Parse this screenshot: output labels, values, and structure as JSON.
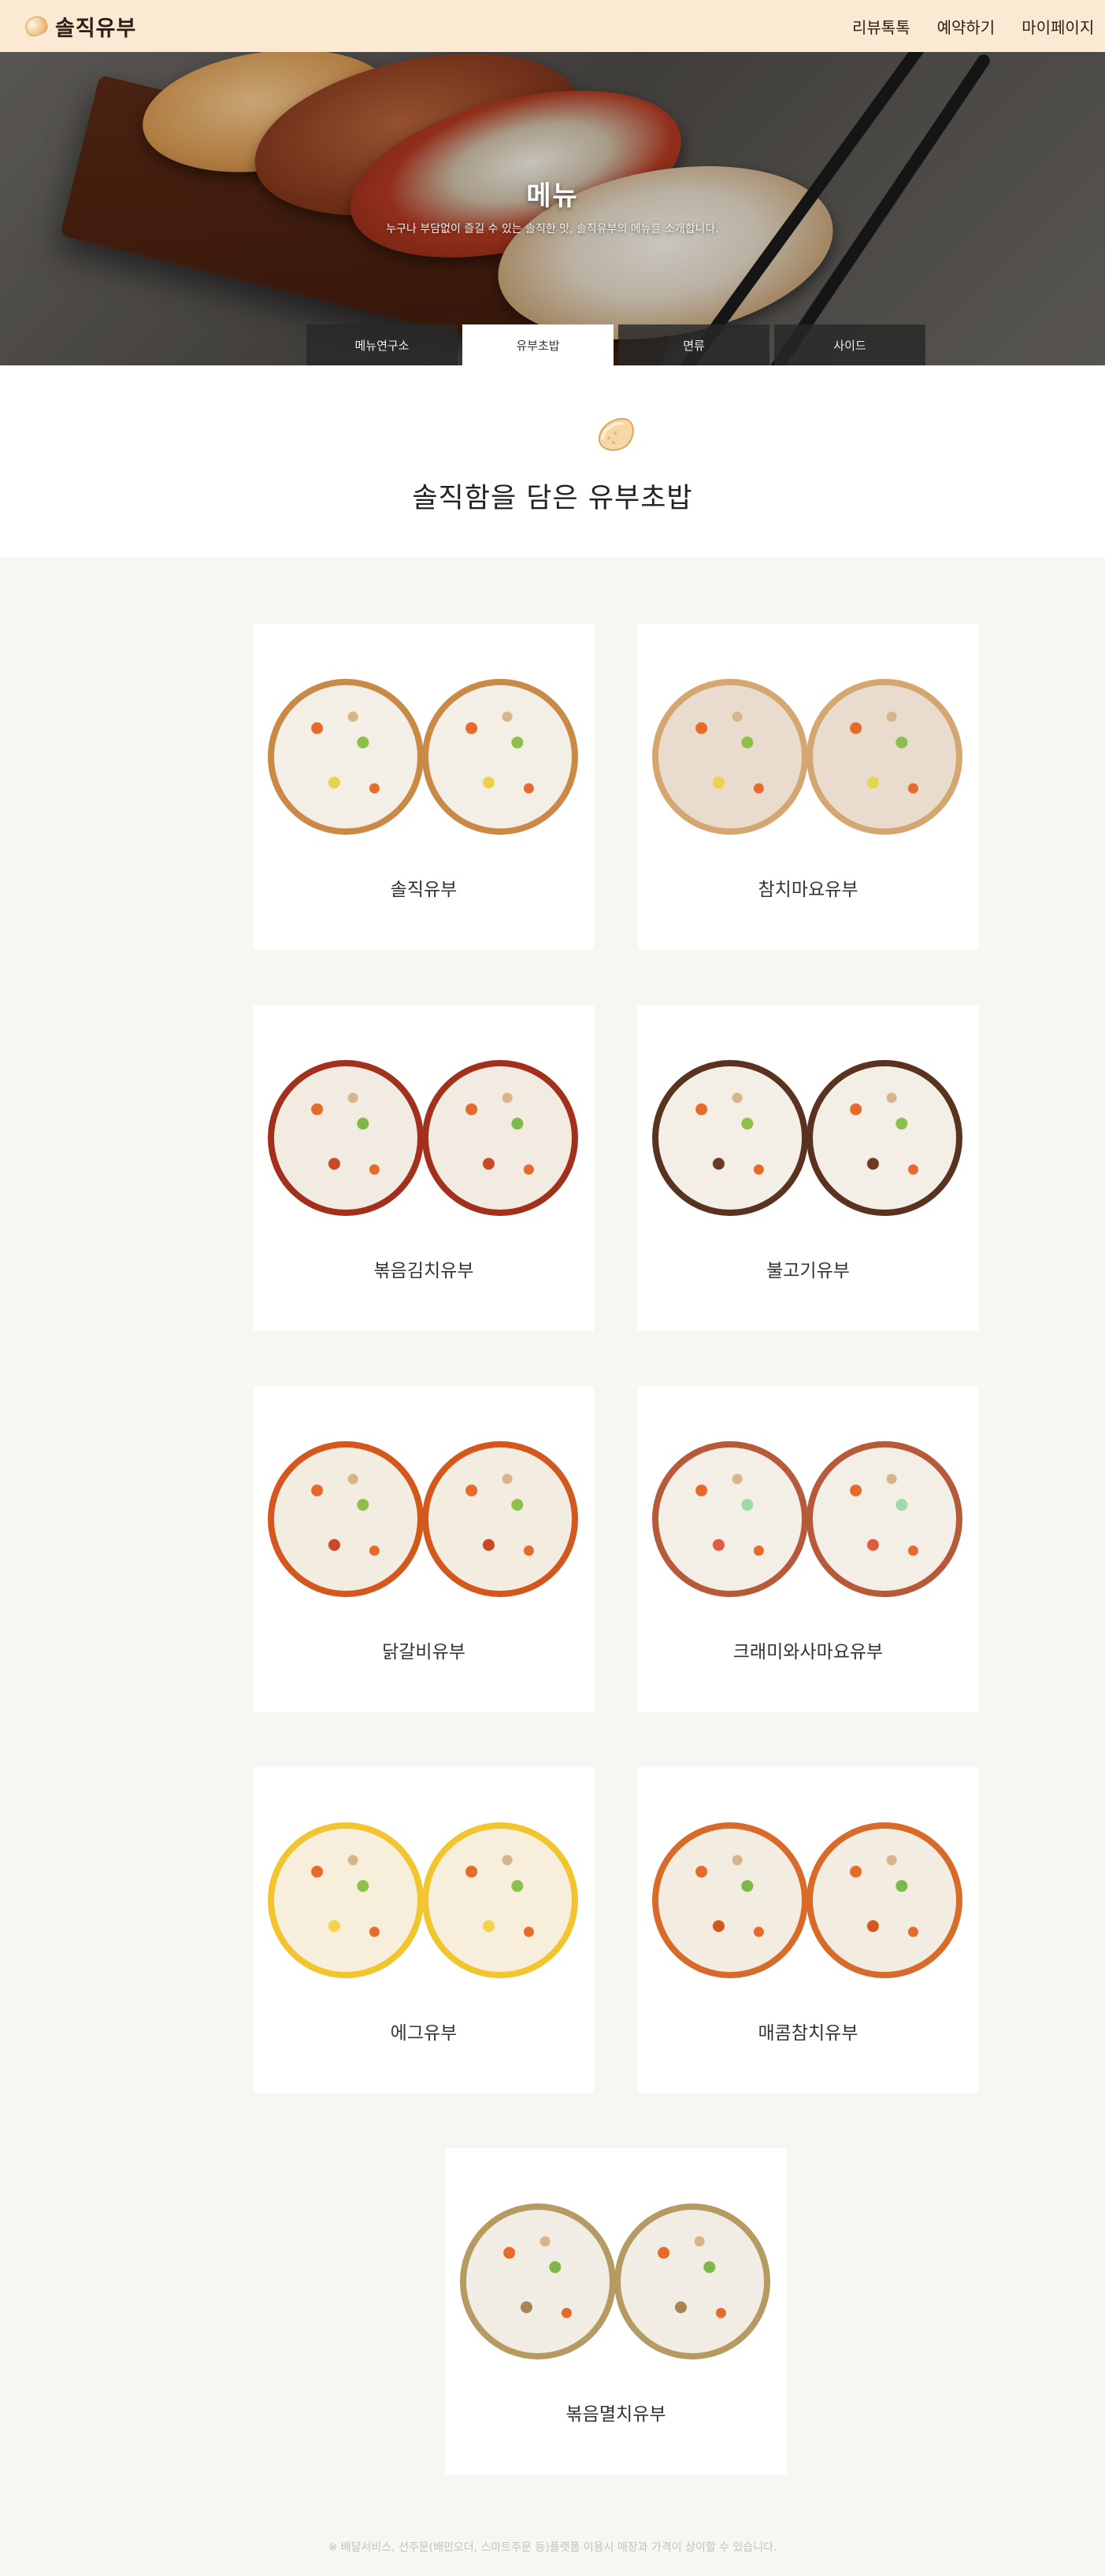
{
  "header": {
    "brand": "솔직유부",
    "nav": [
      "리뷰톡톡",
      "예약하기",
      "마이페이지"
    ]
  },
  "hero": {
    "title": "메뉴",
    "subtitle": "누구나 부담없이 즐길 수 있는 솔직한 맛, 솔직유부의 메뉴를 소개합니다.",
    "tabs": [
      "메뉴연구소",
      "유부초밥",
      "면류",
      "사이드"
    ],
    "active_tab": "유부초밥"
  },
  "section": {
    "title": "솔직함을 담은 유부초밥"
  },
  "menu": [
    {
      "name": "솔직유부",
      "fill": "#f3eee6",
      "skin": "#c98a45",
      "v1": "#e86a2a",
      "v2": "#8cc04a",
      "v3": "#e8d44a"
    },
    {
      "name": "참치마요유부",
      "fill": "#e9dccf",
      "skin": "#d4a670",
      "v1": "#e86a2a",
      "v2": "#8cc04a",
      "v3": "#e8d44a"
    },
    {
      "name": "볶음김치유부",
      "fill": "#f1ebe1",
      "skin": "#a3301d",
      "v1": "#e86a2a",
      "v2": "#7db84a",
      "v3": "#c84828"
    },
    {
      "name": "불고기유부",
      "fill": "#f3eee6",
      "skin": "#5a3220",
      "v1": "#e86a2a",
      "v2": "#8cc04a",
      "v3": "#6a3a22"
    },
    {
      "name": "닭갈비유부",
      "fill": "#f3ece1",
      "skin": "#d4581e",
      "v1": "#e86a2a",
      "v2": "#8cc04a",
      "v3": "#c84828"
    },
    {
      "name": "크래미와사마요유부",
      "fill": "#f4efe6",
      "skin": "#b65a3a",
      "v1": "#e86a2a",
      "v2": "#9ed9a8",
      "v3": "#e05a45"
    },
    {
      "name": "에그유부",
      "fill": "#f7eedc",
      "skin": "#f2c42e",
      "v1": "#e86a2a",
      "v2": "#8cc04a",
      "v3": "#f4d24a"
    },
    {
      "name": "매콤참치유부",
      "fill": "#f3ece1",
      "skin": "#d86a2a",
      "v1": "#e86a2a",
      "v2": "#7db84a",
      "v3": "#d4581e"
    },
    {
      "name": "볶음멸치유부",
      "fill": "#f2ede4",
      "skin": "#b59a62",
      "v1": "#e86a2a",
      "v2": "#7db84a",
      "v3": "#a68552"
    }
  ],
  "footnote": "※ 배달서비스, 선주문(배민오더, 스마트주문 등)플랫폼 이용시 매장과 가격이 상이할 수 있습니다."
}
